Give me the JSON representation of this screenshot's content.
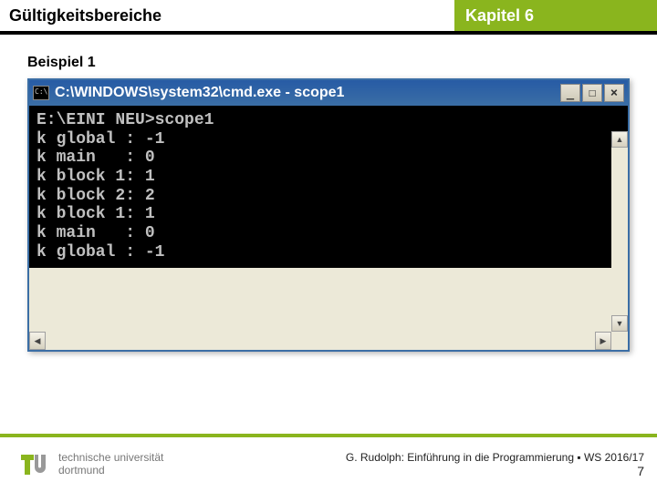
{
  "header": {
    "left_title": "Gültigkeitsbereiche",
    "right_title": "Kapitel 6"
  },
  "subtitle": "Beispiel 1",
  "window": {
    "title": "C:\\WINDOWS\\system32\\cmd.exe - scope1",
    "btn_min": "_",
    "btn_max": "☐",
    "btn_close": "×",
    "output_lines": [
      "E:\\EINI NEU>scope1",
      "k global : -1",
      "k main   : 0",
      "k block 1: 1",
      "k block 2: 2",
      "k block 1: 1",
      "k main   : 0",
      "k global : -1"
    ]
  },
  "footer": {
    "uni_line1": "technische universität",
    "uni_line2": "dortmund",
    "credit": "G. Rudolph: Einführung in die Programmierung ▪ WS 2016/17",
    "page": "7"
  }
}
